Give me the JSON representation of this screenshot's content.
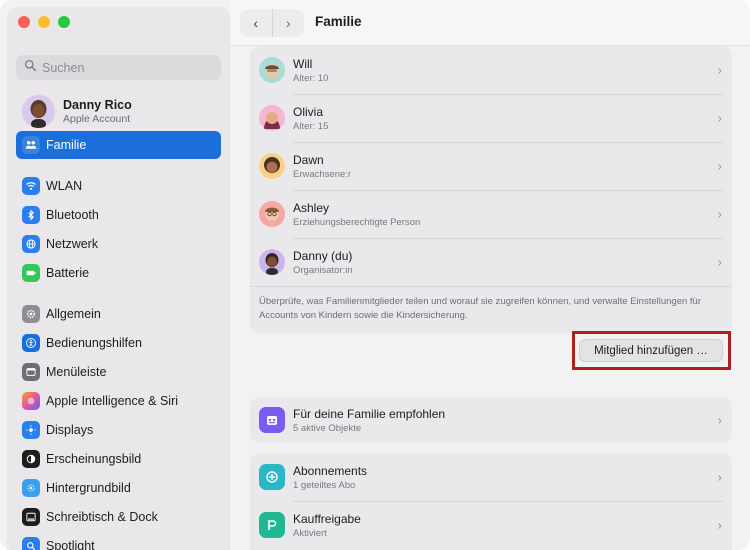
{
  "window": {
    "title": "Familie"
  },
  "sidebar": {
    "search_placeholder": "Suchen",
    "account": {
      "name": "Danny Rico",
      "subtitle": "Apple Account"
    },
    "items": [
      {
        "label": "Familie",
        "icon": "family-icon",
        "color": "#1b6fdb"
      },
      {
        "label": "WLAN",
        "icon": "wifi-icon",
        "color": "#2a7ef2"
      },
      {
        "label": "Bluetooth",
        "icon": "bluetooth-icon",
        "color": "#2a7ef2"
      },
      {
        "label": "Netzwerk",
        "icon": "globe-icon",
        "color": "#2a7ef2"
      },
      {
        "label": "Batterie",
        "icon": "battery-icon",
        "color": "#34c759"
      },
      {
        "label": "Allgemein",
        "icon": "gear-icon",
        "color": "#8e8e93"
      },
      {
        "label": "Bedienungshilfen",
        "icon": "accessibility-icon",
        "color": "#1b6fdb"
      },
      {
        "label": "Menüleiste",
        "icon": "menubar-icon",
        "color": "#6e6e73"
      },
      {
        "label": "Apple Intelligence & Siri",
        "icon": "siri-icon",
        "color": "#e0569e"
      },
      {
        "label": "Displays",
        "icon": "display-icon",
        "color": "#2a7ef2"
      },
      {
        "label": "Erscheinungsbild",
        "icon": "appearance-icon",
        "color": "#1d1d1f"
      },
      {
        "label": "Hintergrundbild",
        "icon": "wallpaper-icon",
        "color": "#3aa0f2"
      },
      {
        "label": "Schreibtisch & Dock",
        "icon": "dock-icon",
        "color": "#1d1d1f"
      },
      {
        "label": "Spotlight",
        "icon": "spotlight-icon",
        "color": "#2a7ef2"
      }
    ]
  },
  "members": [
    {
      "name": "Will",
      "role": "Alter: 10",
      "avatar": "memoji-will",
      "bg": "#a9dcd8"
    },
    {
      "name": "Olivia",
      "role": "Alter: 15",
      "avatar": "memoji-olivia",
      "bg": "#f3b8d0"
    },
    {
      "name": "Dawn",
      "role": "Erwachsene:r",
      "avatar": "memoji-dawn",
      "bg": "#f7d08a"
    },
    {
      "name": "Ashley",
      "role": "Erziehungsberechtigte Person",
      "avatar": "memoji-ashley",
      "bg": "#f4a7a3"
    },
    {
      "name": "Danny (du)",
      "role": "Organisator:in",
      "avatar": "memoji-danny",
      "bg": "#c9b6ec"
    }
  ],
  "note": "Überprüfe, was Familienmitglieder teilen und worauf sie zugreifen können, und verwalte Einstellungen für Accounts von Kindern sowie die Kindersicherung.",
  "add_member_button": "Mitglied hinzufügen …",
  "recommended": {
    "title": "Für deine Familie empfohlen",
    "subtitle": "5 aktive Objekte"
  },
  "services": [
    {
      "title": "Abonnements",
      "subtitle": "1 geteiltes Abo",
      "icon": "subscriptions-icon"
    },
    {
      "title": "Kauffreigabe",
      "subtitle": "Aktiviert",
      "icon": "purchase-sharing-icon"
    }
  ]
}
